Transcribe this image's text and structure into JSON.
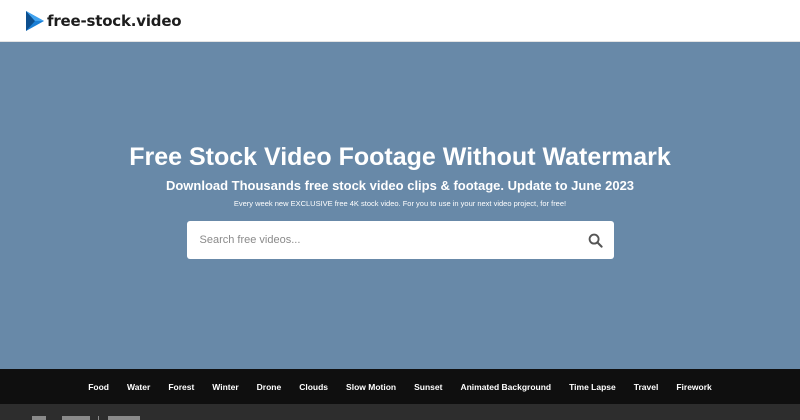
{
  "header": {
    "logo_text": "free-stock.video",
    "logo_icon": "play-arrow-logo-icon"
  },
  "hero": {
    "title": "Free Stock Video Footage Without Watermark",
    "subtitle": "Download Thousands free stock video clips & footage. Update to June 2023",
    "note": "Every week new EXCLUSIVE free 4K stock video. For you to use in your next video project, for free!",
    "background_color": "#6889a8"
  },
  "search": {
    "placeholder": "Search free videos...",
    "icon": "search-icon"
  },
  "categories": {
    "items": [
      {
        "label": "Food"
      },
      {
        "label": "Water"
      },
      {
        "label": "Forest"
      },
      {
        "label": "Winter"
      },
      {
        "label": "Drone"
      },
      {
        "label": "Clouds"
      },
      {
        "label": "Slow Motion"
      },
      {
        "label": "Sunset"
      },
      {
        "label": "Animated Background"
      },
      {
        "label": "Time Lapse"
      },
      {
        "label": "Travel"
      },
      {
        "label": "Firework"
      }
    ]
  },
  "colors": {
    "accent_blue": "#1a7fd6",
    "category_bar": "#0f0f0f"
  }
}
